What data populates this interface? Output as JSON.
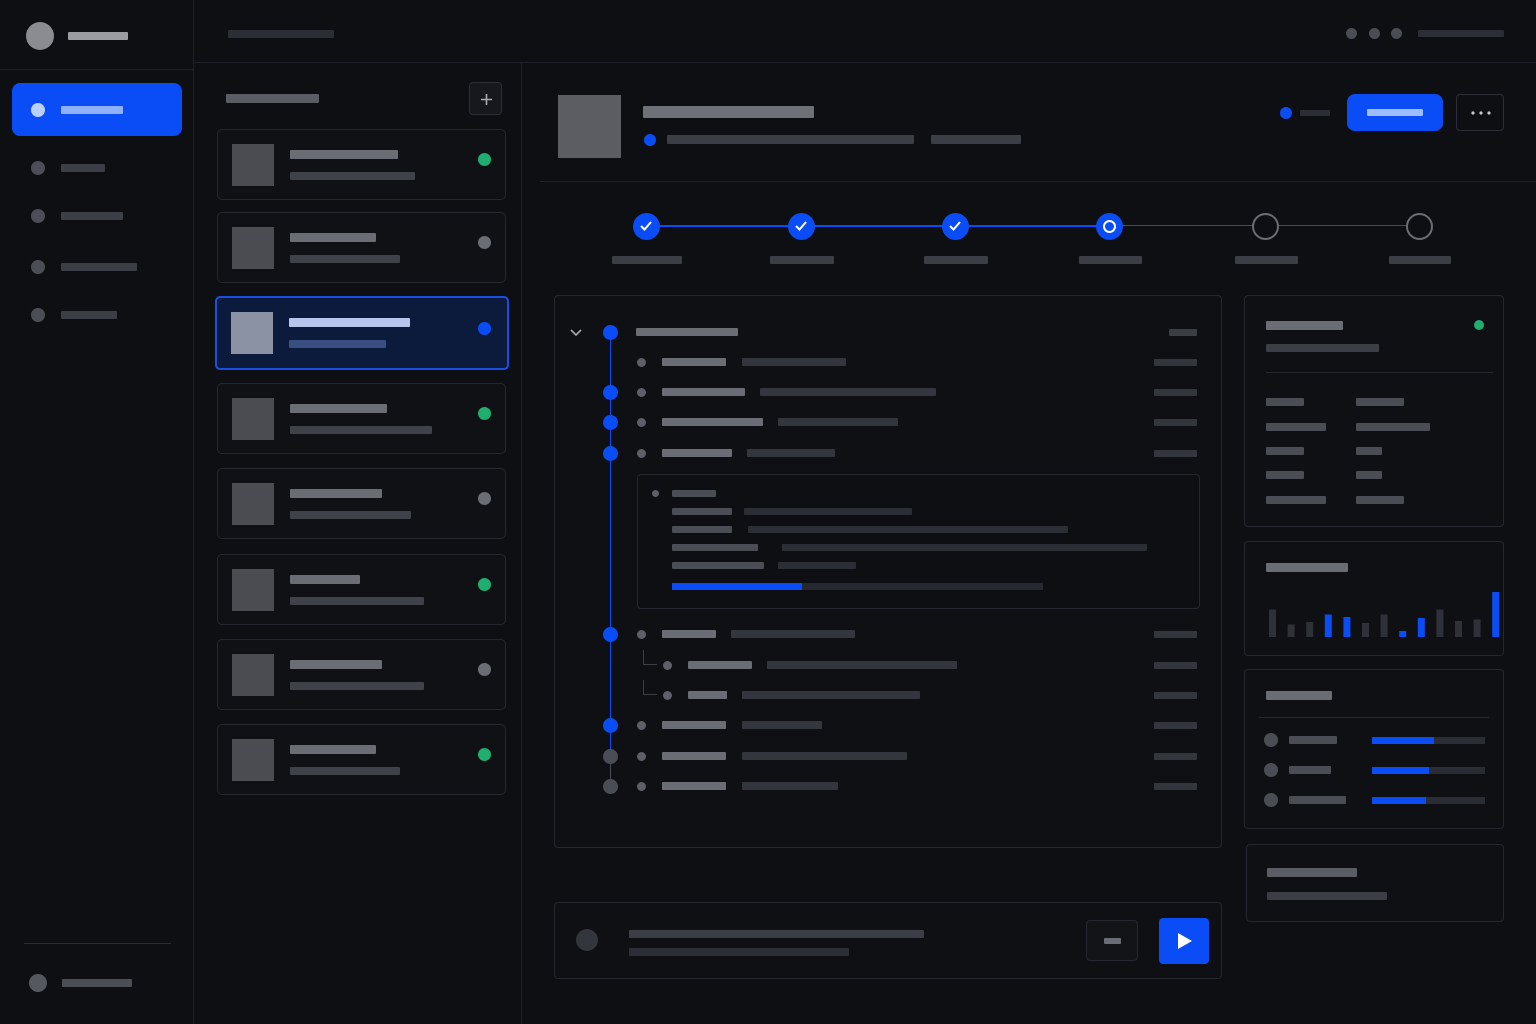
{
  "app": {
    "title": ""
  },
  "sidebar": {
    "items": [
      {
        "label": "",
        "active": true
      },
      {
        "label": "",
        "active": false
      },
      {
        "label": "",
        "active": false
      },
      {
        "label": "",
        "active": false
      },
      {
        "label": "",
        "active": false
      }
    ],
    "footer_label": ""
  },
  "topbar": {
    "breadcrumb": "",
    "user_label": ""
  },
  "list": {
    "title": "",
    "add_icon": "plus-icon",
    "items": [
      {
        "title": "",
        "subtitle": "",
        "status": "success"
      },
      {
        "title": "",
        "subtitle": "",
        "status": "idle"
      },
      {
        "title": "",
        "subtitle": "",
        "status": "active",
        "selected": true
      },
      {
        "title": "",
        "subtitle": "",
        "status": "success"
      },
      {
        "title": "",
        "subtitle": "",
        "status": "idle"
      },
      {
        "title": "",
        "subtitle": "",
        "status": "success"
      },
      {
        "title": "",
        "subtitle": "",
        "status": "idle"
      },
      {
        "title": "",
        "subtitle": "",
        "status": "success"
      }
    ]
  },
  "detail": {
    "title": "",
    "subtitle": "",
    "meta": "",
    "status_label": "",
    "primary_button": "",
    "more_icon": "more-horizontal-icon",
    "steps": [
      {
        "label": "",
        "state": "done"
      },
      {
        "label": "",
        "state": "done"
      },
      {
        "label": "",
        "state": "done"
      },
      {
        "label": "",
        "state": "current"
      },
      {
        "label": "",
        "state": "todo"
      },
      {
        "label": "",
        "state": "todo"
      }
    ]
  },
  "properties": {
    "title": "",
    "subtitle": ""
  },
  "activity_chart": {
    "title": "",
    "values": [
      0.55,
      0.25,
      0.3,
      0.45,
      0.4,
      0.28,
      0.45,
      0.12,
      0.38,
      0.55,
      0.32,
      0.35,
      0.9
    ],
    "highlight": [
      false,
      false,
      false,
      true,
      true,
      false,
      false,
      true,
      true,
      false,
      false,
      false,
      true
    ]
  },
  "progress": {
    "title": "",
    "values": [
      0.55,
      0.5,
      0.48
    ]
  },
  "footer_card": {
    "title": "",
    "subtitle": ""
  },
  "composer": {
    "placeholder": "",
    "send_icon": "play-icon"
  },
  "colors": {
    "accent": "#0a4cf5",
    "success": "#1fae6f",
    "idle": "#6a6d74",
    "background": "#0d0f13"
  }
}
